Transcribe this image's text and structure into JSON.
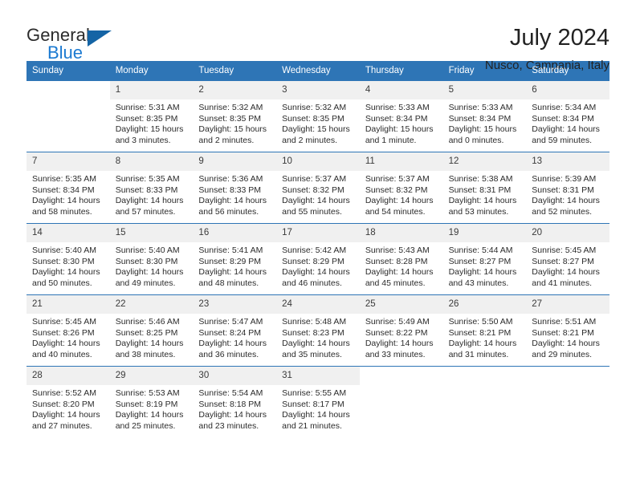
{
  "brand": {
    "name_part1": "General",
    "name_part2": "Blue",
    "logo_icon": "triangle-logo-icon"
  },
  "header": {
    "title": "July 2024",
    "location": "Nusco, Campania, Italy"
  },
  "calendar": {
    "weekday_headers": [
      "Sunday",
      "Monday",
      "Tuesday",
      "Wednesday",
      "Thursday",
      "Friday",
      "Saturday"
    ],
    "accent_color": "#2E75B6",
    "daynum_band_color": "#F0F0F0",
    "weeks": [
      [
        {
          "day": "",
          "lines": []
        },
        {
          "day": "1",
          "lines": [
            "Sunrise: 5:31 AM",
            "Sunset: 8:35 PM",
            "Daylight: 15 hours",
            "and 3 minutes."
          ]
        },
        {
          "day": "2",
          "lines": [
            "Sunrise: 5:32 AM",
            "Sunset: 8:35 PM",
            "Daylight: 15 hours",
            "and 2 minutes."
          ]
        },
        {
          "day": "3",
          "lines": [
            "Sunrise: 5:32 AM",
            "Sunset: 8:35 PM",
            "Daylight: 15 hours",
            "and 2 minutes."
          ]
        },
        {
          "day": "4",
          "lines": [
            "Sunrise: 5:33 AM",
            "Sunset: 8:34 PM",
            "Daylight: 15 hours",
            "and 1 minute."
          ]
        },
        {
          "day": "5",
          "lines": [
            "Sunrise: 5:33 AM",
            "Sunset: 8:34 PM",
            "Daylight: 15 hours",
            "and 0 minutes."
          ]
        },
        {
          "day": "6",
          "lines": [
            "Sunrise: 5:34 AM",
            "Sunset: 8:34 PM",
            "Daylight: 14 hours",
            "and 59 minutes."
          ]
        }
      ],
      [
        {
          "day": "7",
          "lines": [
            "Sunrise: 5:35 AM",
            "Sunset: 8:34 PM",
            "Daylight: 14 hours",
            "and 58 minutes."
          ]
        },
        {
          "day": "8",
          "lines": [
            "Sunrise: 5:35 AM",
            "Sunset: 8:33 PM",
            "Daylight: 14 hours",
            "and 57 minutes."
          ]
        },
        {
          "day": "9",
          "lines": [
            "Sunrise: 5:36 AM",
            "Sunset: 8:33 PM",
            "Daylight: 14 hours",
            "and 56 minutes."
          ]
        },
        {
          "day": "10",
          "lines": [
            "Sunrise: 5:37 AM",
            "Sunset: 8:32 PM",
            "Daylight: 14 hours",
            "and 55 minutes."
          ]
        },
        {
          "day": "11",
          "lines": [
            "Sunrise: 5:37 AM",
            "Sunset: 8:32 PM",
            "Daylight: 14 hours",
            "and 54 minutes."
          ]
        },
        {
          "day": "12",
          "lines": [
            "Sunrise: 5:38 AM",
            "Sunset: 8:31 PM",
            "Daylight: 14 hours",
            "and 53 minutes."
          ]
        },
        {
          "day": "13",
          "lines": [
            "Sunrise: 5:39 AM",
            "Sunset: 8:31 PM",
            "Daylight: 14 hours",
            "and 52 minutes."
          ]
        }
      ],
      [
        {
          "day": "14",
          "lines": [
            "Sunrise: 5:40 AM",
            "Sunset: 8:30 PM",
            "Daylight: 14 hours",
            "and 50 minutes."
          ]
        },
        {
          "day": "15",
          "lines": [
            "Sunrise: 5:40 AM",
            "Sunset: 8:30 PM",
            "Daylight: 14 hours",
            "and 49 minutes."
          ]
        },
        {
          "day": "16",
          "lines": [
            "Sunrise: 5:41 AM",
            "Sunset: 8:29 PM",
            "Daylight: 14 hours",
            "and 48 minutes."
          ]
        },
        {
          "day": "17",
          "lines": [
            "Sunrise: 5:42 AM",
            "Sunset: 8:29 PM",
            "Daylight: 14 hours",
            "and 46 minutes."
          ]
        },
        {
          "day": "18",
          "lines": [
            "Sunrise: 5:43 AM",
            "Sunset: 8:28 PM",
            "Daylight: 14 hours",
            "and 45 minutes."
          ]
        },
        {
          "day": "19",
          "lines": [
            "Sunrise: 5:44 AM",
            "Sunset: 8:27 PM",
            "Daylight: 14 hours",
            "and 43 minutes."
          ]
        },
        {
          "day": "20",
          "lines": [
            "Sunrise: 5:45 AM",
            "Sunset: 8:27 PM",
            "Daylight: 14 hours",
            "and 41 minutes."
          ]
        }
      ],
      [
        {
          "day": "21",
          "lines": [
            "Sunrise: 5:45 AM",
            "Sunset: 8:26 PM",
            "Daylight: 14 hours",
            "and 40 minutes."
          ]
        },
        {
          "day": "22",
          "lines": [
            "Sunrise: 5:46 AM",
            "Sunset: 8:25 PM",
            "Daylight: 14 hours",
            "and 38 minutes."
          ]
        },
        {
          "day": "23",
          "lines": [
            "Sunrise: 5:47 AM",
            "Sunset: 8:24 PM",
            "Daylight: 14 hours",
            "and 36 minutes."
          ]
        },
        {
          "day": "24",
          "lines": [
            "Sunrise: 5:48 AM",
            "Sunset: 8:23 PM",
            "Daylight: 14 hours",
            "and 35 minutes."
          ]
        },
        {
          "day": "25",
          "lines": [
            "Sunrise: 5:49 AM",
            "Sunset: 8:22 PM",
            "Daylight: 14 hours",
            "and 33 minutes."
          ]
        },
        {
          "day": "26",
          "lines": [
            "Sunrise: 5:50 AM",
            "Sunset: 8:21 PM",
            "Daylight: 14 hours",
            "and 31 minutes."
          ]
        },
        {
          "day": "27",
          "lines": [
            "Sunrise: 5:51 AM",
            "Sunset: 8:21 PM",
            "Daylight: 14 hours",
            "and 29 minutes."
          ]
        }
      ],
      [
        {
          "day": "28",
          "lines": [
            "Sunrise: 5:52 AM",
            "Sunset: 8:20 PM",
            "Daylight: 14 hours",
            "and 27 minutes."
          ]
        },
        {
          "day": "29",
          "lines": [
            "Sunrise: 5:53 AM",
            "Sunset: 8:19 PM",
            "Daylight: 14 hours",
            "and 25 minutes."
          ]
        },
        {
          "day": "30",
          "lines": [
            "Sunrise: 5:54 AM",
            "Sunset: 8:18 PM",
            "Daylight: 14 hours",
            "and 23 minutes."
          ]
        },
        {
          "day": "31",
          "lines": [
            "Sunrise: 5:55 AM",
            "Sunset: 8:17 PM",
            "Daylight: 14 hours",
            "and 21 minutes."
          ]
        },
        {
          "day": "",
          "lines": []
        },
        {
          "day": "",
          "lines": []
        },
        {
          "day": "",
          "lines": []
        }
      ]
    ]
  }
}
